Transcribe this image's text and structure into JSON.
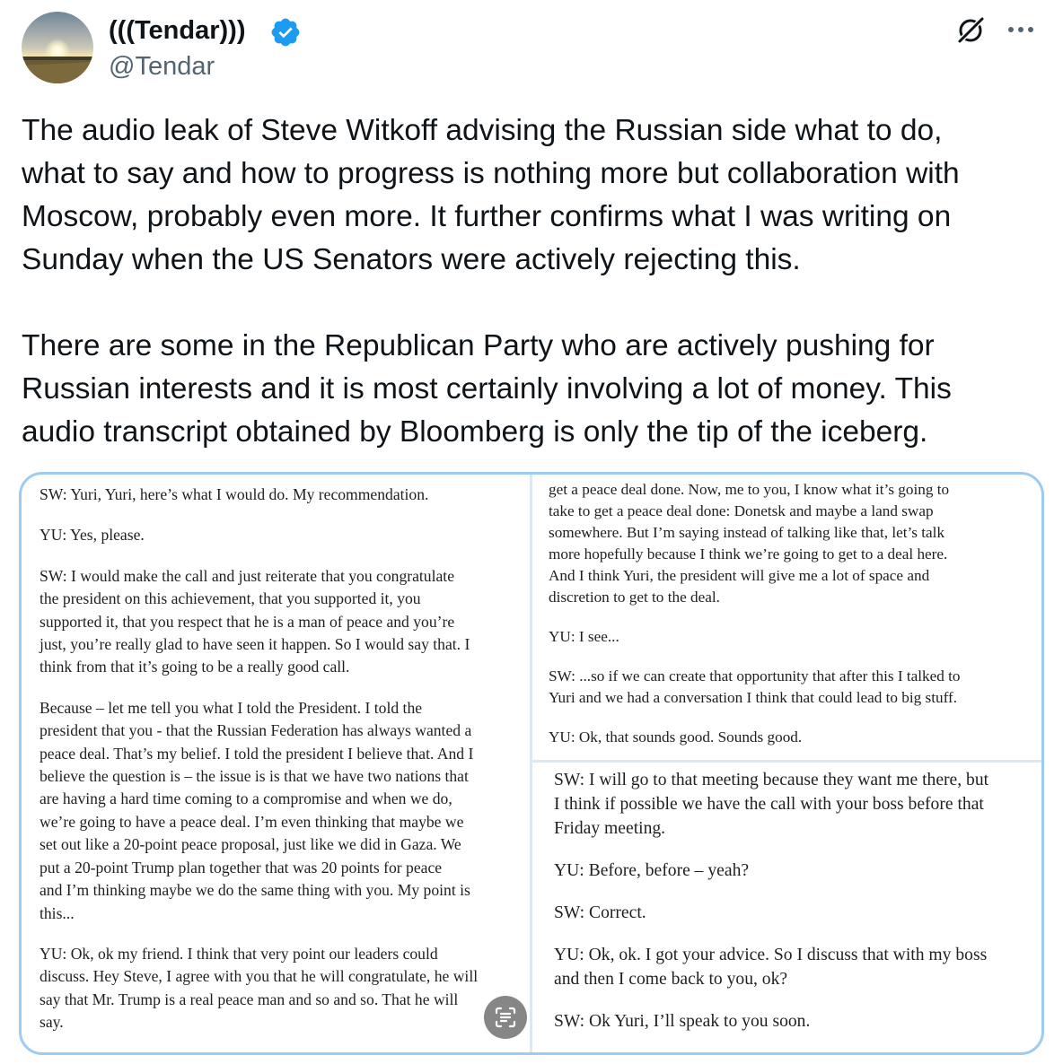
{
  "author": {
    "name": "(((Tendar)))",
    "handle": "@Tendar",
    "verified_icon": "verified-badge-icon",
    "badge_color": "#1d9bf0"
  },
  "header_icons": [
    "grok-icon",
    "more-icon"
  ],
  "tweet": {
    "paragraphs": [
      "The audio leak of Steve Witkoff advising the Russian side what to do,\nwhat to say and how to progress is nothing more but collaboration with\nMoscow, probably even more. It further confirms what I was writing on\nSunday when the US Senators were actively rejecting this.",
      "There are some in the Republican Party who are actively pushing for\nRussian interests and it is most certainly involving a lot of money. This\naudio transcript obtained by Bloomberg is only the tip of the iceberg."
    ]
  },
  "media": {
    "border_color": "#9ecbef",
    "left_column": [
      "SW: Yuri, Yuri, here’s what I would do. My recommendation.",
      "YU: Yes, please.",
      "SW: I would make the call and just reiterate that you congratulate\nthe president on this achievement, that you supported it, you\nsupported it, that you respect that he is a man of peace and you’re\njust, you’re really glad to have seen it happen. So I would say that. I\nthink from that it’s going to be a really good call.",
      "Because – let me tell you what I told the President. I told the\npresident that you - that the Russian Federation has always wanted a\npeace deal. That’s my belief. I told the president I believe that. And I\nbelieve the question is – the issue is is that we have two nations that\nare having a hard time coming to a compromise and when we do,\nwe’re going to have a peace deal. I’m even thinking that maybe we\nset out like a 20-point peace proposal, just like we did in Gaza. We\nput a 20-point Trump plan together that was 20 points for peace\nand I’m thinking maybe we do the same thing with you. My point is\nthis...",
      "YU: Ok, ok my friend. I think that very point our leaders could\ndiscuss. Hey Steve, I agree with you that he will congratulate, he will\nsay that Mr. Trump is a real peace man and so and so. That he will\nsay."
    ],
    "right_top": [
      "get a peace deal done. Now, me to you, I know what it’s going to\ntake to get a peace deal done: Donetsk and maybe a land swap\nsomewhere. But I’m saying instead of talking like that, let’s talk\nmore hopefully because I think we’re going to get to a deal here.\nAnd I think Yuri, the president will give me a lot of space and\ndiscretion to get to the deal.",
      "YU: I see...",
      "SW: ...so if we can create that opportunity that after this I talked to\nYuri and we had a conversation I think that could lead to big stuff.",
      "YU: Ok, that sounds good. Sounds good."
    ],
    "right_bottom": [
      "SW: I will go to that meeting because they want me there, but\nI think if possible we have the call with your boss before that\nFriday meeting.",
      "YU: Before, before – yeah?",
      "SW: Correct.",
      "YU: Ok, ok. I got your advice. So I discuss that with my boss\nand then I come back to you, ok?",
      "SW: Ok Yuri, I’ll speak to you soon."
    ],
    "overlay_icon": "text-recognition-icon"
  }
}
